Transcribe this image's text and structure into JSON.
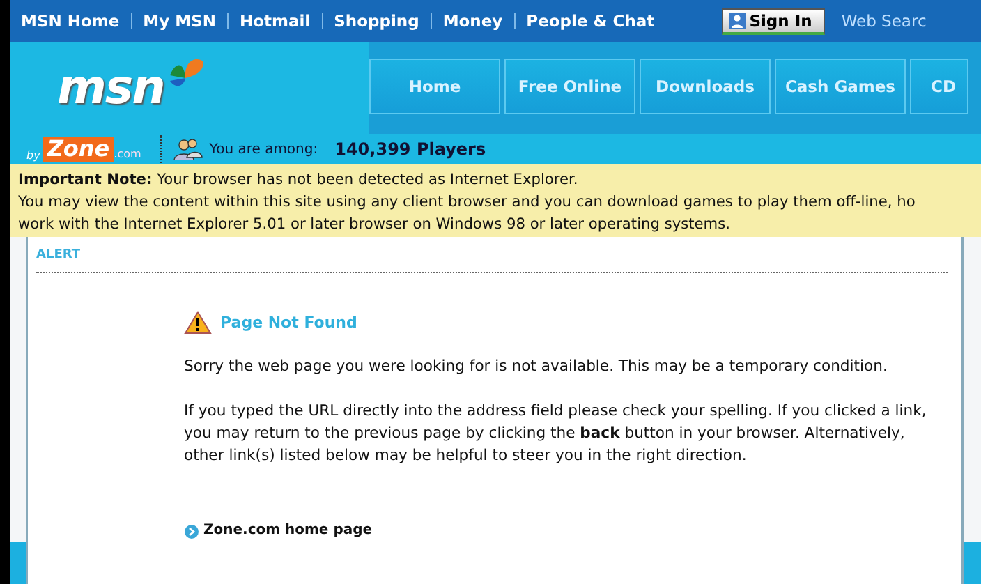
{
  "top_nav": {
    "links": [
      "MSN Home",
      "My MSN",
      "Hotmail",
      "Shopping",
      "Money",
      "People & Chat"
    ],
    "sign_in": "Sign In",
    "search_label": "Web Searc"
  },
  "header": {
    "logo": "msn",
    "tabs": [
      "Home",
      "Free Online",
      "Downloads",
      "Cash Games",
      "CD"
    ]
  },
  "zone_bar": {
    "logo_prefix": "by",
    "logo": "Zone",
    "logo_suffix": ".com",
    "label": "You are among:",
    "count": "140,399 Players"
  },
  "note": {
    "lines": [
      "**Important Note:** Your browser has not been detected as Internet Explorer.",
      "You may view the content within this site using any client browser and you can download games to play them off-line, ho",
      "work with the Internet Explorer 5.01 or later browser on Windows 98 or later operating systems."
    ]
  },
  "alert": {
    "heading": "ALERT",
    "title": "Page Not Found",
    "paragraphs": [
      "Sorry the web page you were looking for is not available. This may be a temporary condition.",
      "If you typed the URL directly into the address field please check your spelling. If you clicked a link, you may return to the previous page by clicking the **back** button in your browser. Alternatively, other link(s) listed below may be helpful to steer you in the right direction."
    ],
    "links": [
      "Zone.com home page"
    ]
  }
}
